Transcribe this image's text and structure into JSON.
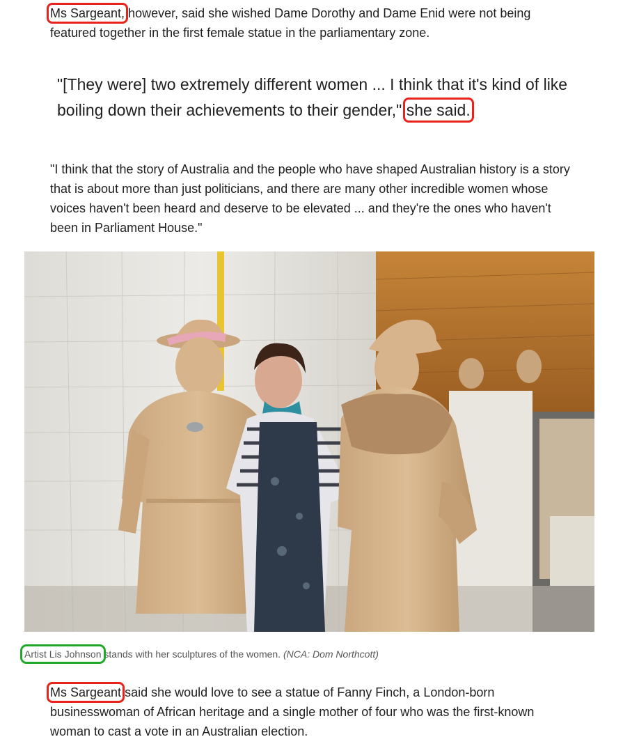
{
  "article": {
    "p1": {
      "speaker": "Ms Sargeant,",
      "rest": " however, said she wished Dame Dorothy and Dame Enid were not being featured together in the first female statue in the parliamentary zone."
    },
    "quote": {
      "text": "\"[They were] two extremely different women ... I think that it's kind of like boiling down their achievements to their gender,\" ",
      "attribution": "she said."
    },
    "p2": {
      "text": "\"I think that the story of Australia and the people who have shaped Australian history is a story that is about more than just politicians, and there are many other incredible women whose voices haven't been heard and deserve to be elevated ... and they're the ones who haven't been in Parliament House.\""
    },
    "figure": {
      "caption_subject": "Artist Lis Johnson",
      "caption_rest": " stands with her sculptures of the women. ",
      "credit": "(NCA: Dom Northcott)"
    },
    "p3": {
      "speaker": "Ms Sargeant",
      "rest": " said she would love to see a statue of Fanny Finch, a London-born businesswoman of African heritage and a single mother of four who was the first-known woman to cast a vote in an Australian election."
    }
  },
  "colors": {
    "highlight_red": "#e8231c",
    "highlight_green": "#1fa82a",
    "text": "#1f1f1f",
    "caption": "#555555"
  }
}
